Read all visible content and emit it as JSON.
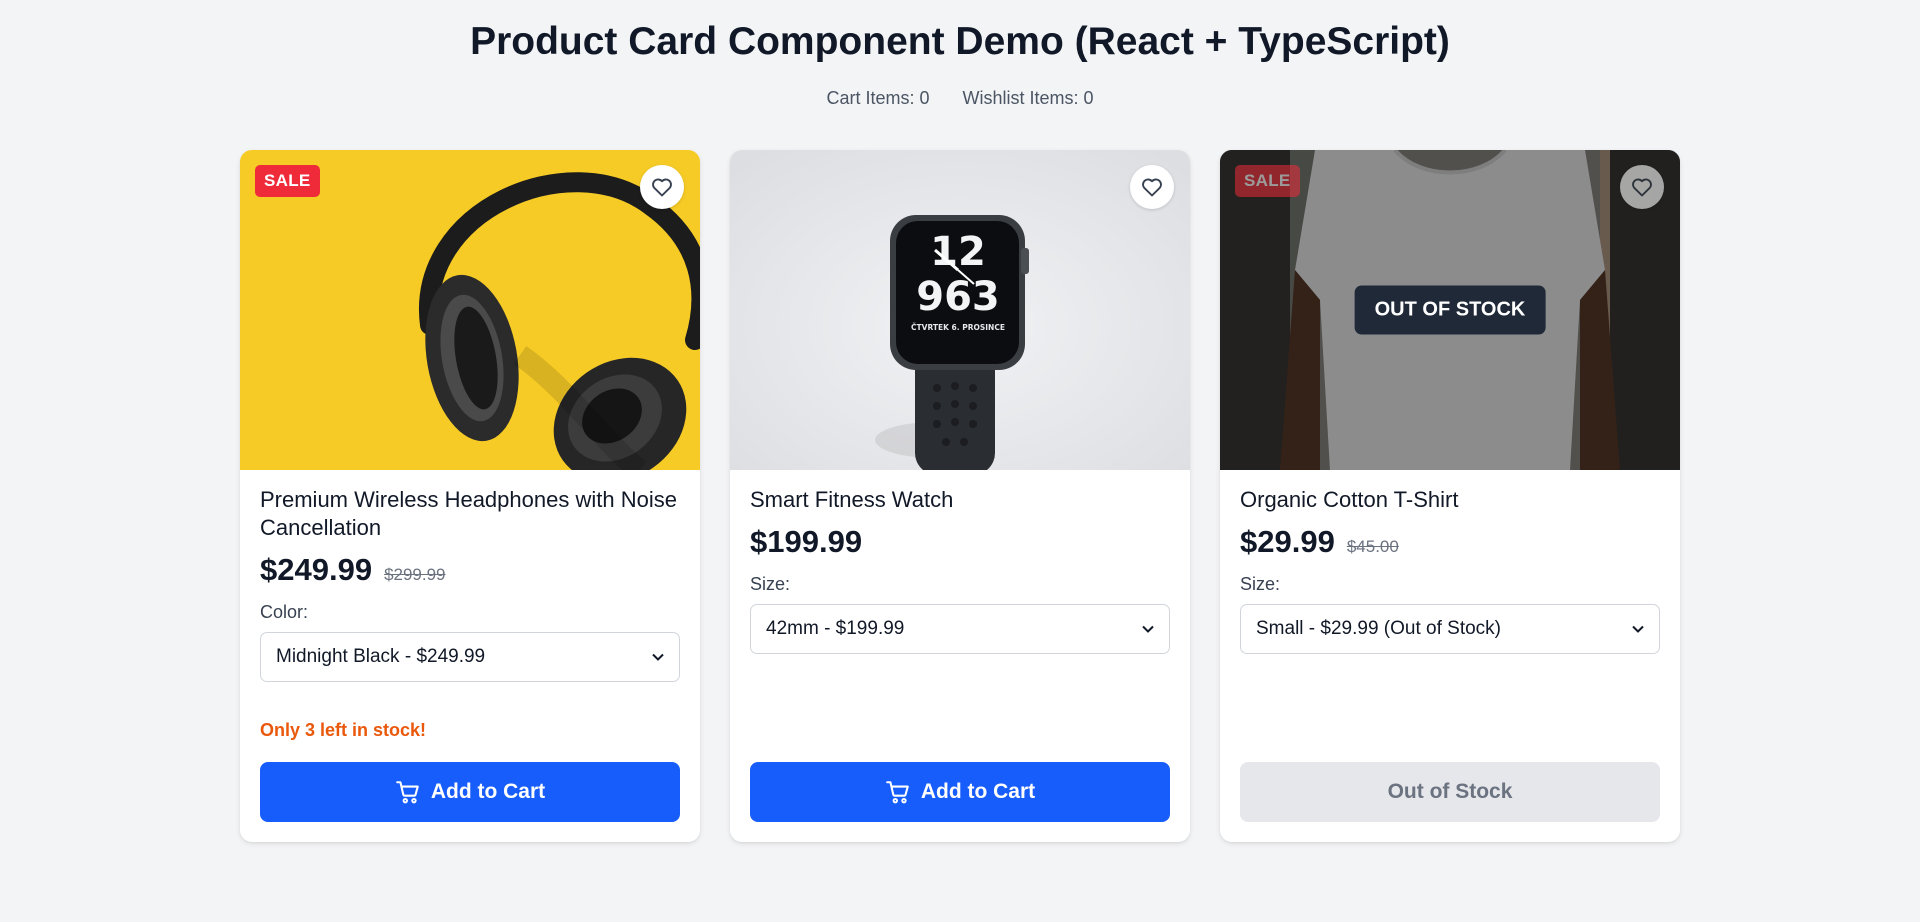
{
  "page": {
    "title": "Product Card Component Demo (React + TypeScript)",
    "cart_label": "Cart Items: 0",
    "wishlist_label": "Wishlist Items: 0"
  },
  "colors": {
    "primary": "#175dfb",
    "sale": "#ef2b3a",
    "warning": "#ea580c",
    "disabled": "#e5e7eb"
  },
  "products": [
    {
      "name": "Premium Wireless Headphones with Noise Cancellation",
      "badge": "SALE",
      "price": "$249.99",
      "original_price": "$299.99",
      "option_label": "Color:",
      "selected_option": "Midnight Black - $249.99",
      "stock_note": "Only 3 left in stock!",
      "button_label": "Add to Cart",
      "image_icon": "headphones-photo"
    },
    {
      "name": "Smart Fitness Watch",
      "price": "$199.99",
      "option_label": "Size:",
      "selected_option": "42mm - $199.99",
      "button_label": "Add to Cart",
      "image_icon": "smartwatch-photo",
      "watch_face": {
        "digits_top": "12",
        "digits_bottom": "963",
        "date": "ČTVRTEK 6. PROSINCE"
      }
    },
    {
      "name": "Organic Cotton T-Shirt",
      "badge": "SALE",
      "price": "$29.99",
      "original_price": "$45.00",
      "option_label": "Size:",
      "selected_option": "Small - $29.99 (Out of Stock)",
      "overlay_label": "OUT OF STOCK",
      "button_label": "Out of Stock",
      "image_icon": "tshirt-photo"
    }
  ]
}
